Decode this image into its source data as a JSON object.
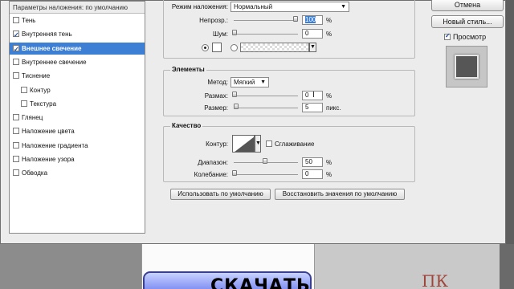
{
  "dialog": {
    "style_list": {
      "header": "Параметры наложения: по умолчанию",
      "items": [
        {
          "label": "Тень",
          "checked": false,
          "selected": false,
          "indent": false
        },
        {
          "label": "Внутренняя тень",
          "checked": true,
          "selected": false,
          "indent": false
        },
        {
          "label": "Внешнее свечение",
          "checked": true,
          "selected": true,
          "indent": false
        },
        {
          "label": "Внутреннее свечение",
          "checked": false,
          "selected": false,
          "indent": false
        },
        {
          "label": "Тиснение",
          "checked": false,
          "selected": false,
          "indent": false
        },
        {
          "label": "Контур",
          "checked": false,
          "selected": false,
          "indent": true
        },
        {
          "label": "Текстура",
          "checked": false,
          "selected": false,
          "indent": true
        },
        {
          "label": "Глянец",
          "checked": false,
          "selected": false,
          "indent": false
        },
        {
          "label": "Наложение цвета",
          "checked": false,
          "selected": false,
          "indent": false
        },
        {
          "label": "Наложение градиента",
          "checked": false,
          "selected": false,
          "indent": false
        },
        {
          "label": "Наложение узора",
          "checked": false,
          "selected": false,
          "indent": false
        },
        {
          "label": "Обводка",
          "checked": false,
          "selected": false,
          "indent": false
        }
      ]
    },
    "structure": {
      "blend_mode_label": "Режим наложения:",
      "blend_mode_value": "Нормальный",
      "opacity_label": "Непрозр.:",
      "opacity_value": "100",
      "opacity_unit": "%",
      "noise_label": "Шум:",
      "noise_value": "0",
      "noise_unit": "%"
    },
    "elements": {
      "title": "Элементы",
      "technique_label": "Метод:",
      "technique_value": "Мягкий",
      "spread_label": "Размах:",
      "spread_value": "0",
      "spread_unit": "%",
      "size_label": "Размер:",
      "size_value": "5",
      "size_unit": "пикс."
    },
    "quality": {
      "title": "Качество",
      "contour_label": "Контур:",
      "antialias_label": "Сглаживание",
      "range_label": "Диапазон:",
      "range_value": "50",
      "range_unit": "%",
      "jitter_label": "Колебание:",
      "jitter_value": "0",
      "jitter_unit": "%"
    },
    "buttons": {
      "make_default": "Использовать по умолчанию",
      "reset_default": "Восстановить значения по умолчанию"
    },
    "side": {
      "cancel": "Отмена",
      "new_style": "Новый стиль...",
      "preview_label": "Просмотр"
    }
  },
  "background": {
    "download_text": "СКАЧАТЬ",
    "logo_text": "ПК"
  },
  "colors": {
    "selection": "#3c7fd4",
    "dialog_bg": "#ececec",
    "download_button": "#6e7ff0"
  }
}
